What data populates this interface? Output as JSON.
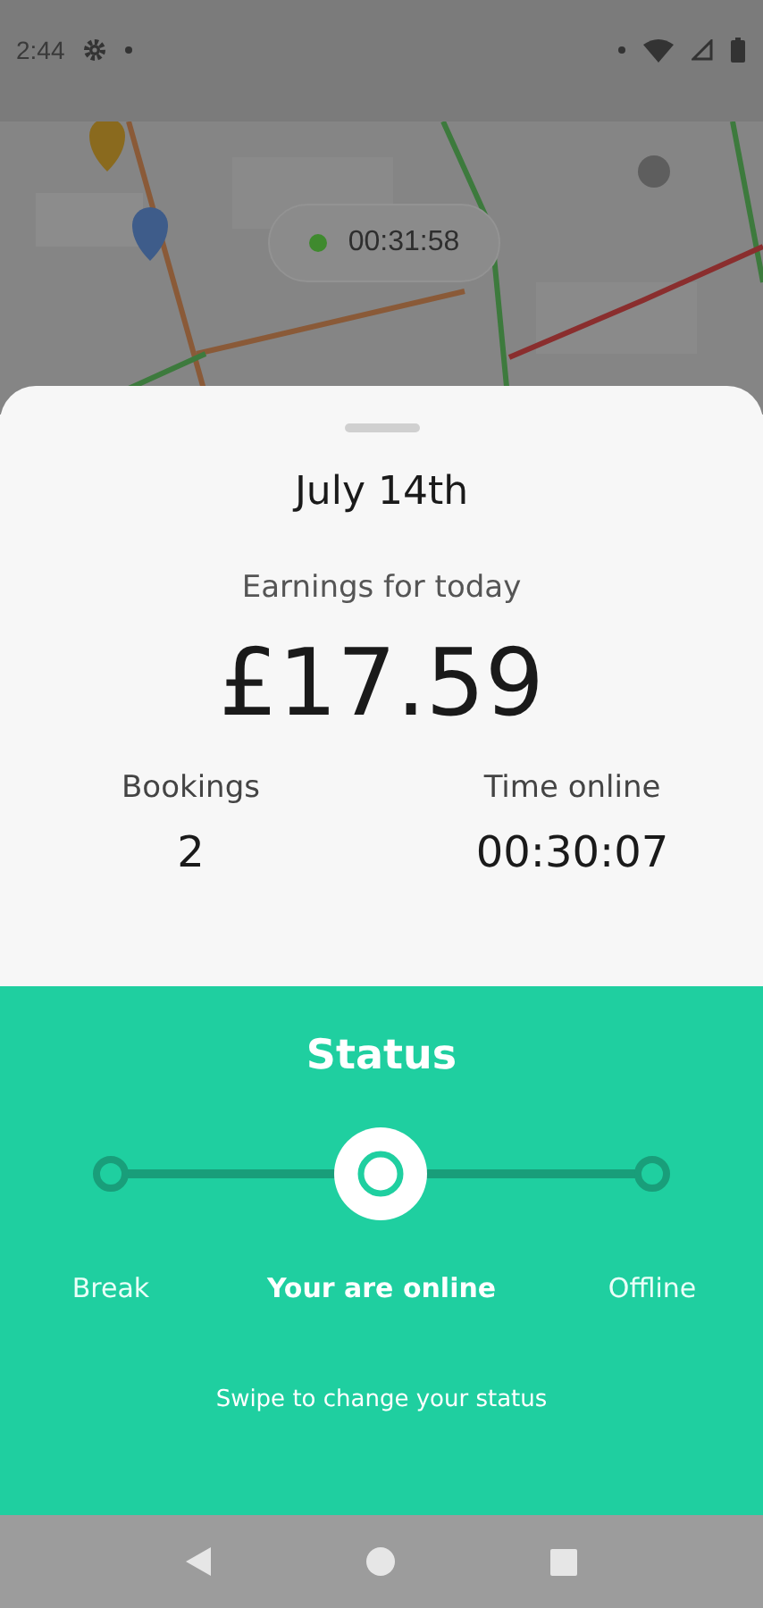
{
  "status_bar": {
    "time": "2:44"
  },
  "map": {
    "kind": "picture",
    "timer": "00:31:58"
  },
  "sheet": {
    "date": "July 14th",
    "earnings_label": "Earnings for today",
    "earnings": "£17.59",
    "stats": [
      {
        "label": "Bookings",
        "value": "2"
      },
      {
        "label": "Time online",
        "value": "00:30:07"
      }
    ]
  },
  "status": {
    "title": "Status",
    "options": [
      {
        "label": "Break",
        "selected": false
      },
      {
        "label": "Your are online",
        "selected": true
      },
      {
        "label": "Offline",
        "selected": false
      }
    ],
    "hint": "Swipe to change your status"
  }
}
